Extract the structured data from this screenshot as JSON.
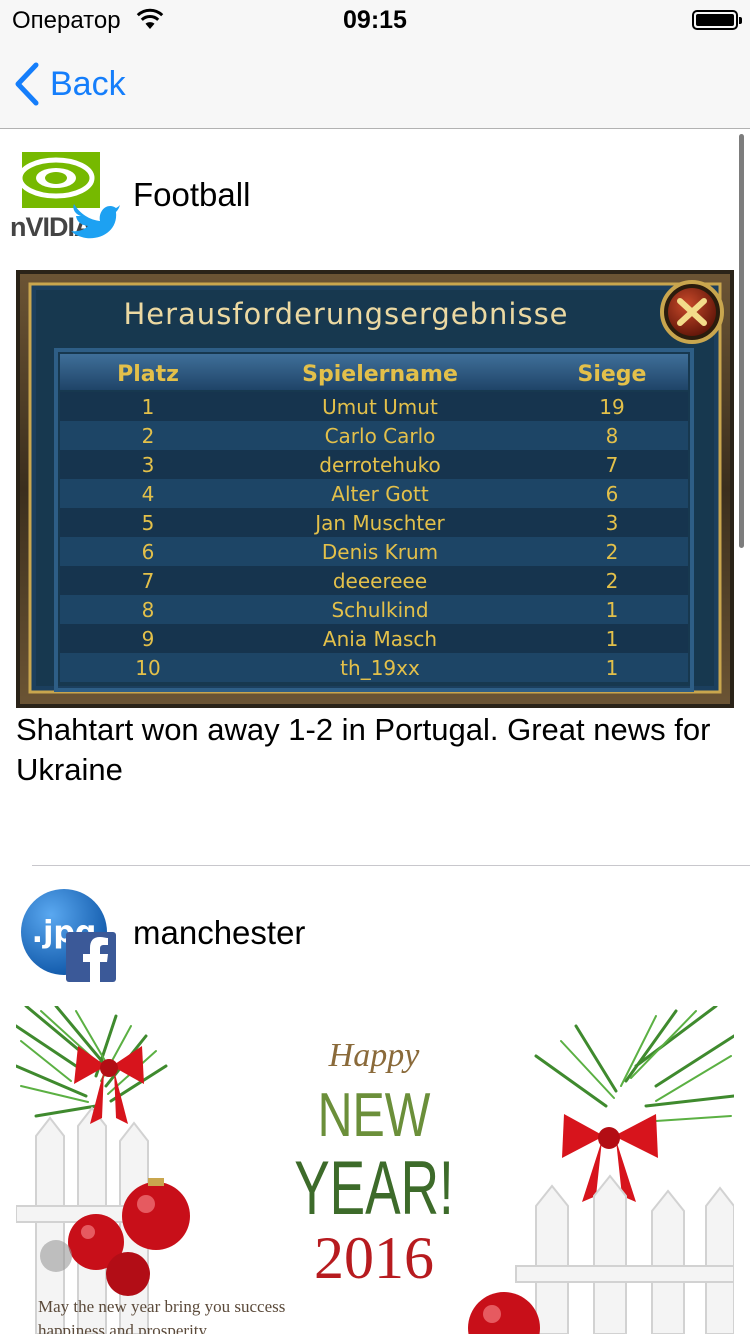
{
  "status_bar": {
    "carrier": "Оператор",
    "time": "09:15"
  },
  "nav": {
    "back_label": "Back"
  },
  "posts": [
    {
      "author": "Football",
      "network": "twitter",
      "avatar_icon": "nvidia-logo-icon",
      "text": "Shahtart won away 1-2 in Portugal. Great news for Ukraine",
      "image": {
        "title": "Herausforderungsergebnisse",
        "headers": [
          "Platz",
          "Spielername",
          "Siege"
        ],
        "rows": [
          [
            "1",
            "Umut Umut",
            "19"
          ],
          [
            "2",
            "Carlo Carlo",
            "8"
          ],
          [
            "3",
            "derrotehuko",
            "7"
          ],
          [
            "4",
            "Alter Gott",
            "6"
          ],
          [
            "5",
            "Jan Muschter",
            "3"
          ],
          [
            "6",
            "Denis Krum",
            "2"
          ],
          [
            "7",
            "deeereee",
            "2"
          ],
          [
            "8",
            "Schulkind",
            "1"
          ],
          [
            "9",
            "Ania Masch",
            "1"
          ],
          [
            "10",
            "th_19xx",
            "1"
          ]
        ]
      }
    },
    {
      "author": "manchester",
      "network": "facebook",
      "avatar_icon": "jpg-logo-icon",
      "image": {
        "happy": "Happy",
        "new": "NEW",
        "year": "YEAR!",
        "number": "2016",
        "caption_line1": "May the new year bring you success",
        "caption_line2": "happiness and prosperity"
      }
    }
  ],
  "colors": {
    "accent": "#157efb",
    "twitter": "#1da1f2",
    "facebook": "#3b5998",
    "nvidia_green": "#76b900",
    "game_gold": "#e3c04a",
    "game_blue": "#123a5c"
  }
}
